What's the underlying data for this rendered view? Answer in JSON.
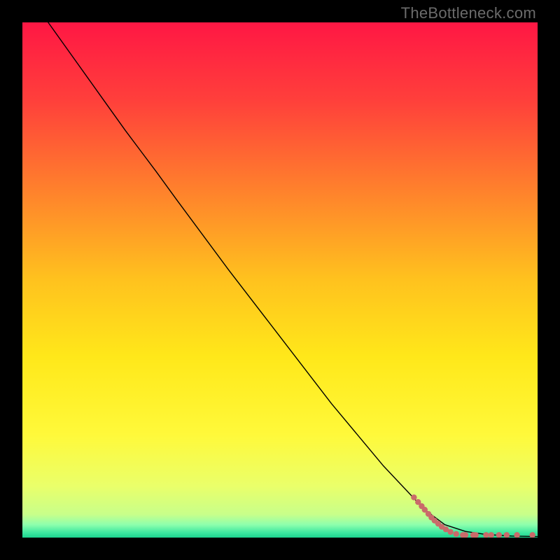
{
  "watermark": "TheBottleneck.com",
  "chart_data": {
    "type": "line",
    "title": "",
    "xlabel": "",
    "ylabel": "",
    "xlim": [
      0,
      100
    ],
    "ylim": [
      0,
      100
    ],
    "grid": false,
    "legend": false,
    "background": {
      "type": "vertical-gradient",
      "stops": [
        {
          "pos": 0.0,
          "color": "#ff1744"
        },
        {
          "pos": 0.15,
          "color": "#ff3f3b"
        },
        {
          "pos": 0.35,
          "color": "#ff8a2a"
        },
        {
          "pos": 0.5,
          "color": "#ffc21e"
        },
        {
          "pos": 0.65,
          "color": "#ffe81a"
        },
        {
          "pos": 0.8,
          "color": "#fff93a"
        },
        {
          "pos": 0.9,
          "color": "#eaff6a"
        },
        {
          "pos": 0.955,
          "color": "#c8ff8a"
        },
        {
          "pos": 0.975,
          "color": "#8dffad"
        },
        {
          "pos": 0.99,
          "color": "#3fe8a0"
        },
        {
          "pos": 1.0,
          "color": "#1dd38e"
        }
      ]
    },
    "series": [
      {
        "name": "curve",
        "color": "#000000",
        "stroke_width": 1.4,
        "x": [
          5,
          10,
          15,
          20,
          23,
          26,
          30,
          40,
          50,
          60,
          70,
          78,
          82,
          86,
          90,
          95,
          100
        ],
        "y": [
          100,
          93,
          86,
          79,
          75,
          71,
          65.5,
          52,
          39,
          26,
          14,
          5.5,
          2.5,
          1.2,
          0.6,
          0.3,
          0.2
        ]
      }
    ],
    "scatter": {
      "name": "markers",
      "color": "#c96a6a",
      "radius": 4.2,
      "points": [
        {
          "x": 76.0,
          "y": 7.8
        },
        {
          "x": 76.8,
          "y": 6.9
        },
        {
          "x": 77.5,
          "y": 6.1
        },
        {
          "x": 78.1,
          "y": 5.4
        },
        {
          "x": 78.8,
          "y": 4.6
        },
        {
          "x": 79.4,
          "y": 3.9
        },
        {
          "x": 80.0,
          "y": 3.3
        },
        {
          "x": 80.7,
          "y": 2.7
        },
        {
          "x": 81.4,
          "y": 2.1
        },
        {
          "x": 82.2,
          "y": 1.6
        },
        {
          "x": 83.1,
          "y": 1.1
        },
        {
          "x": 84.2,
          "y": 0.7
        },
        {
          "x": 85.5,
          "y": 0.5
        },
        {
          "x": 86.0,
          "y": 0.5
        },
        {
          "x": 87.5,
          "y": 0.5
        },
        {
          "x": 88.0,
          "y": 0.5
        },
        {
          "x": 90.0,
          "y": 0.5
        },
        {
          "x": 91.0,
          "y": 0.5
        },
        {
          "x": 92.5,
          "y": 0.5
        },
        {
          "x": 94.0,
          "y": 0.5
        },
        {
          "x": 96.0,
          "y": 0.5
        },
        {
          "x": 99.0,
          "y": 0.5
        }
      ]
    }
  }
}
